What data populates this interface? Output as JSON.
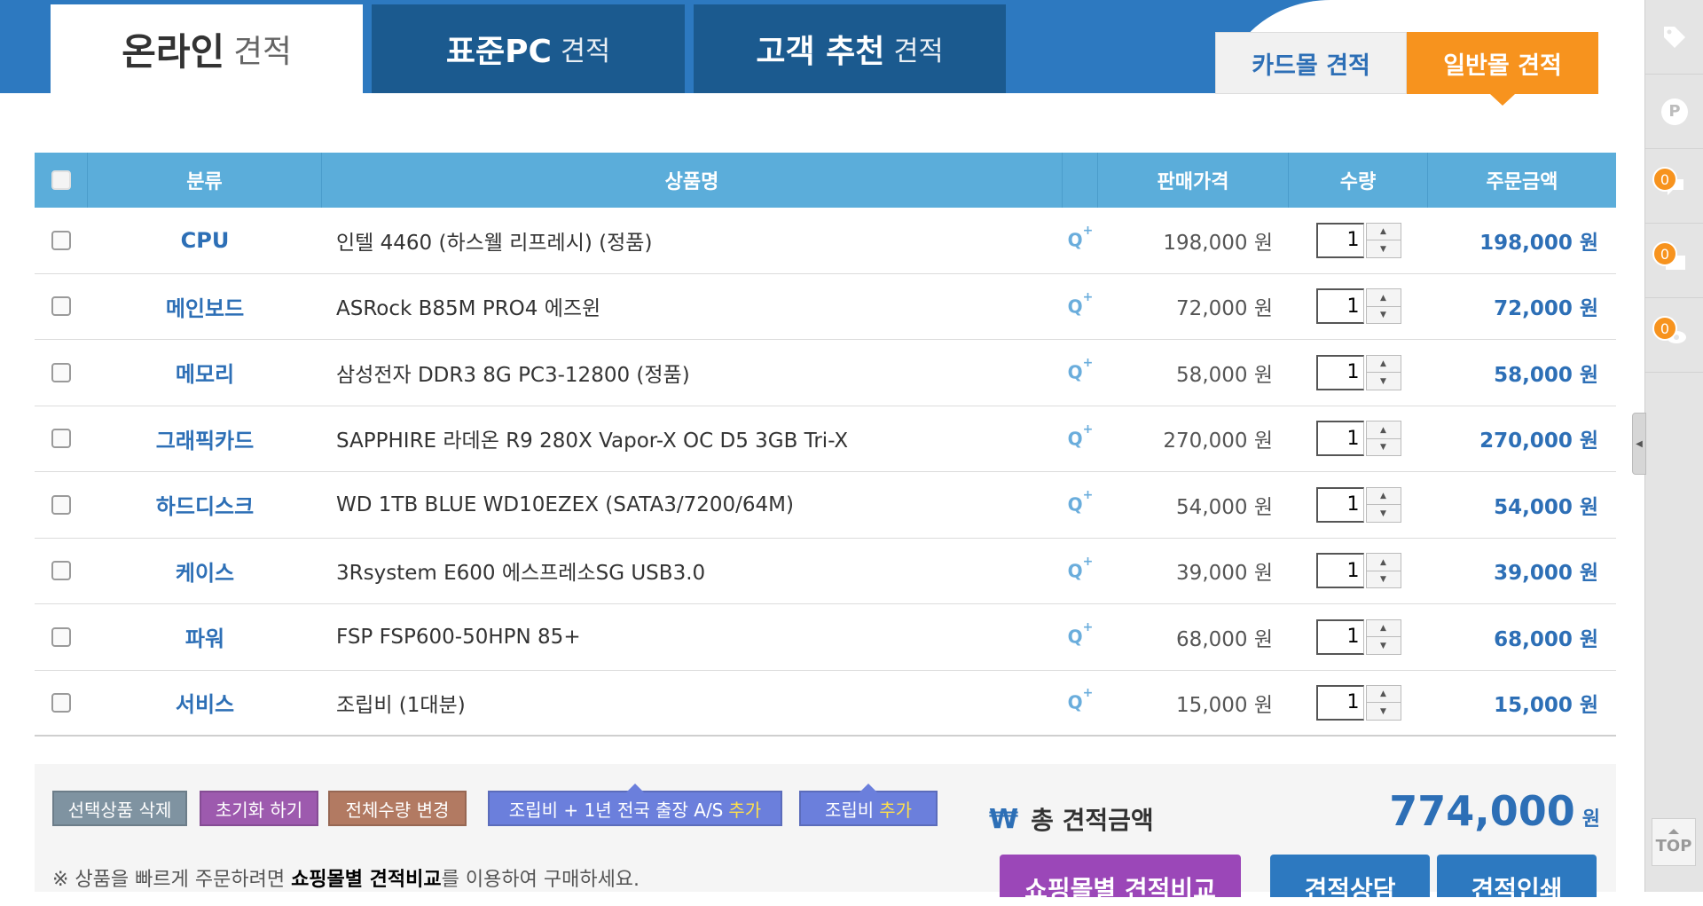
{
  "header": {
    "tabs": [
      {
        "main": "온라인",
        "sub": "견적"
      },
      {
        "main": "표준PC",
        "sub": "견적"
      },
      {
        "main": "고객 추천",
        "sub": "견적"
      }
    ],
    "mall_tabs": {
      "card": "카드몰 견적",
      "general": "일반몰 견적"
    }
  },
  "table": {
    "headers": {
      "category": "분류",
      "name": "상품명",
      "price": "판매가격",
      "qty": "수량",
      "amount": "주문금액"
    },
    "zoom_label": "Q",
    "zoom_plus": "+",
    "rows": [
      {
        "category": "CPU",
        "name": "인텔 4460 (하스웰 리프레시) (정품)",
        "price": "198,000 원",
        "qty": "1",
        "amount": "198,000 원"
      },
      {
        "category": "메인보드",
        "name": "ASRock B85M PRO4 에즈윈",
        "price": "72,000 원",
        "qty": "1",
        "amount": "72,000 원"
      },
      {
        "category": "메모리",
        "name": "삼성전자 DDR3 8G PC3-12800 (정품)",
        "price": "58,000 원",
        "qty": "1",
        "amount": "58,000 원"
      },
      {
        "category": "그래픽카드",
        "name": "SAPPHIRE 라데온 R9 280X Vapor-X OC D5 3GB Tri-X",
        "price": "270,000 원",
        "qty": "1",
        "amount": "270,000 원"
      },
      {
        "category": "하드디스크",
        "name": "WD 1TB BLUE WD10EZEX (SATA3/7200/64M)",
        "price": "54,000 원",
        "qty": "1",
        "amount": "54,000 원"
      },
      {
        "category": "케이스",
        "name": "3Rsystem E600 에스프레소SG USB3.0",
        "price": "39,000 원",
        "qty": "1",
        "amount": "39,000 원"
      },
      {
        "category": "파워",
        "name": "FSP FSP600-50HPN 85+",
        "price": "68,000 원",
        "qty": "1",
        "amount": "68,000 원"
      },
      {
        "category": "서비스",
        "name": "조립비 (1대분)",
        "price": "15,000 원",
        "qty": "1",
        "amount": "15,000 원"
      }
    ]
  },
  "actions": {
    "delete_selected": "선택상품 삭제",
    "reset": "초기화 하기",
    "change_all_qty": "전체수량 변경",
    "assembly_as": "조립비 + 1년 전국 출장 A/S",
    "assembly_as_add": "추가",
    "assembly": "조립비",
    "assembly_add": "추가"
  },
  "total": {
    "currency_symbol": "₩",
    "label": "총 견적금액",
    "value": "774,000",
    "unit": "원"
  },
  "note": {
    "prefix": "※ 상품을 빠르게 주문하려면 ",
    "bold": "쇼핑몰별 견적비교",
    "suffix": "를 이용하여 구매하세요."
  },
  "bottom_buttons": {
    "compare": "쇼핑몰별 견적비교",
    "consult": "견적상담",
    "print": "견적인쇄"
  },
  "rail": {
    "badges": [
      "0",
      "0",
      "0"
    ],
    "point_label": "P",
    "top_label": "TOP"
  },
  "colors": {
    "primary_blue": "#2d79c0",
    "header_blue": "#5badda",
    "accent_orange": "#f7931e",
    "purple": "#9b47b8"
  }
}
